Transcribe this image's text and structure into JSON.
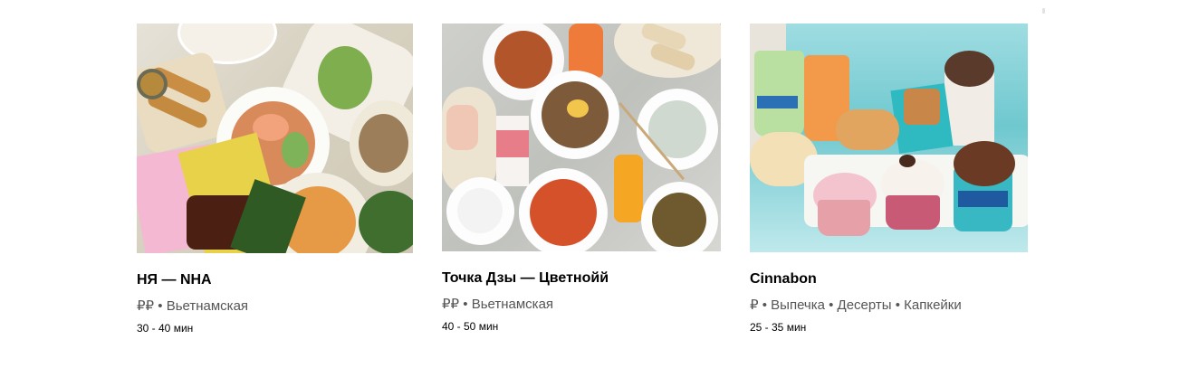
{
  "restaurants": [
    {
      "name": "НЯ — NHA",
      "price": "₽₽",
      "cuisines": "Вьетнамская",
      "delivery_time": "30 - 40 мин"
    },
    {
      "name": "Точка Дзы — Цветнойй",
      "price": "₽₽",
      "cuisines": "Вьетнамская",
      "delivery_time": "40 - 50 мин"
    },
    {
      "name": "Cinnabon",
      "price": "₽",
      "cuisines": "Выпечка • Десерты • Капкейки",
      "delivery_time": "25 - 35 мин"
    }
  ],
  "separator": "•"
}
